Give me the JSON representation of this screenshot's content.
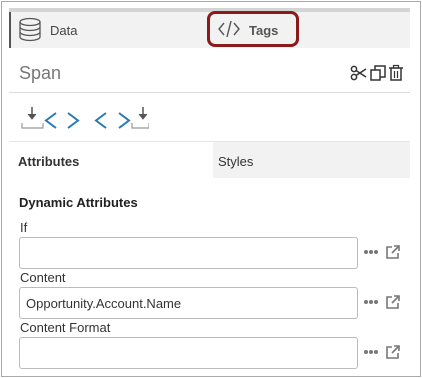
{
  "tabs": {
    "data_label": "Data",
    "tags_label": "Tags"
  },
  "component": {
    "title": "Span"
  },
  "attr_tabs": {
    "attributes_label": "Attributes",
    "styles_label": "Styles"
  },
  "dynamic": {
    "heading": "Dynamic Attributes",
    "fields": [
      {
        "label": "If",
        "value": ""
      },
      {
        "label": "Content",
        "value": "Opportunity.Account.Name"
      },
      {
        "label": "Content Format",
        "value": ""
      }
    ]
  },
  "icons": {
    "data_tab": "database-icon",
    "tags_tab": "code-icon",
    "cut": "scissors-icon",
    "copy": "copy-icon",
    "delete": "trash-icon",
    "insert_before": "insert-before-icon",
    "insert_after": "insert-after-icon",
    "more": "more-dots-icon",
    "open": "external-link-icon"
  },
  "colors": {
    "accent": "#2a7ab8",
    "highlight": "#8b1a1a",
    "tab_bg": "#f2f2f2"
  }
}
